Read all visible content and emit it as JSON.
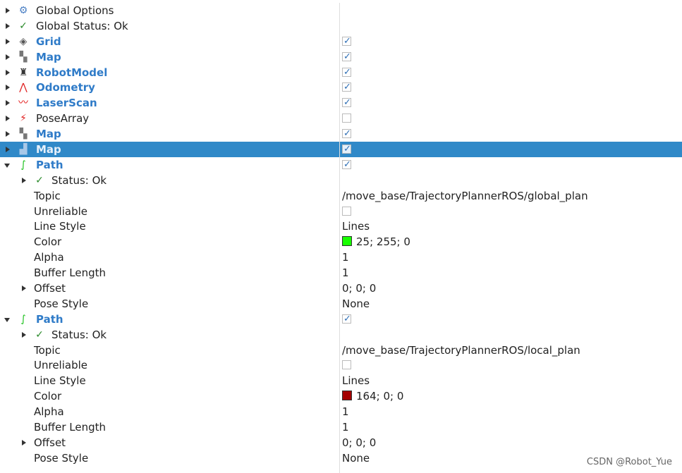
{
  "rows": [
    {
      "level": 0,
      "expand": "right",
      "icon": "gear-icon",
      "glyph": "⚙",
      "icolor": "#4a7fc4",
      "label": "Global Options",
      "display": false
    },
    {
      "level": 0,
      "expand": "right",
      "icon": "check-icon",
      "glyph": "✓",
      "icolor": "#2a8a2a",
      "label": "Global Status: Ok",
      "display": false
    },
    {
      "level": 0,
      "expand": "right",
      "icon": "grid-icon",
      "glyph": "◈",
      "icolor": "#555",
      "label": "Grid",
      "display": true,
      "checkbox": true
    },
    {
      "level": 0,
      "expand": "right",
      "icon": "map-icon",
      "glyph": "▚",
      "icolor": "#777",
      "label": "Map",
      "display": true,
      "checkbox": true
    },
    {
      "level": 0,
      "expand": "right",
      "icon": "robot-model-icon",
      "glyph": "♜",
      "icolor": "#333",
      "label": "RobotModel",
      "display": true,
      "checkbox": true
    },
    {
      "level": 0,
      "expand": "right",
      "icon": "odometry-icon",
      "glyph": "⋀",
      "icolor": "#e02020",
      "label": "Odometry",
      "display": true,
      "checkbox": true
    },
    {
      "level": 0,
      "expand": "right",
      "icon": "laser-scan-icon",
      "glyph": "〰",
      "icolor": "#e00000",
      "label": "LaserScan",
      "display": true,
      "checkbox": true
    },
    {
      "level": 0,
      "expand": "right",
      "icon": "pose-array-icon",
      "glyph": "⚡",
      "icolor": "#e02020",
      "label": "PoseArray",
      "display": false,
      "checkbox": false
    },
    {
      "level": 0,
      "expand": "right",
      "icon": "map-icon",
      "glyph": "▚",
      "icolor": "#777",
      "label": "Map",
      "display": true,
      "checkbox": true
    },
    {
      "level": 0,
      "expand": "right",
      "icon": "map-icon",
      "glyph": "▟",
      "icolor": "#a8c8e8",
      "label": "Map",
      "display": true,
      "checkbox": true,
      "selected": true
    },
    {
      "level": 0,
      "expand": "down",
      "icon": "path-icon",
      "glyph": "∫",
      "icolor": "#18c018",
      "label": "Path",
      "display": true,
      "checkbox": true
    },
    {
      "level": 1,
      "expand": "right",
      "icon": "check-icon",
      "glyph": "✓",
      "icolor": "#2a8a2a",
      "label": "Status: Ok"
    },
    {
      "level": 1,
      "label": "Topic",
      "value": "/move_base/TrajectoryPlannerROS/global_plan"
    },
    {
      "level": 1,
      "label": "Unreliable",
      "checkbox": false
    },
    {
      "level": 1,
      "label": "Line Style",
      "value": "Lines"
    },
    {
      "level": 1,
      "label": "Color",
      "value": "25; 255; 0",
      "swatch": "#19ff00"
    },
    {
      "level": 1,
      "label": "Alpha",
      "value": "1"
    },
    {
      "level": 1,
      "label": "Buffer Length",
      "value": "1"
    },
    {
      "level": 1,
      "expand": "right",
      "label": "Offset",
      "value": "0; 0; 0"
    },
    {
      "level": 1,
      "label": "Pose Style",
      "value": "None"
    },
    {
      "level": 0,
      "expand": "down",
      "icon": "path-icon",
      "glyph": "∫",
      "icolor": "#18c018",
      "label": "Path",
      "display": true,
      "checkbox": true
    },
    {
      "level": 1,
      "expand": "right",
      "icon": "check-icon",
      "glyph": "✓",
      "icolor": "#2a8a2a",
      "label": "Status: Ok"
    },
    {
      "level": 1,
      "label": "Topic",
      "value": "/move_base/TrajectoryPlannerROS/local_plan"
    },
    {
      "level": 1,
      "label": "Unreliable",
      "checkbox": false
    },
    {
      "level": 1,
      "label": "Line Style",
      "value": "Lines"
    },
    {
      "level": 1,
      "label": "Color",
      "value": "164; 0; 0",
      "swatch": "#a40000"
    },
    {
      "level": 1,
      "label": "Alpha",
      "value": "1"
    },
    {
      "level": 1,
      "label": "Buffer Length",
      "value": "1"
    },
    {
      "level": 1,
      "expand": "right",
      "label": "Offset",
      "value": "0; 0; 0"
    },
    {
      "level": 1,
      "label": "Pose Style",
      "value": "None"
    }
  ],
  "watermark": "CSDN @Robot_Yue",
  "colors": {
    "selection": "#3089c8",
    "display_label": "#2f7bc8"
  }
}
